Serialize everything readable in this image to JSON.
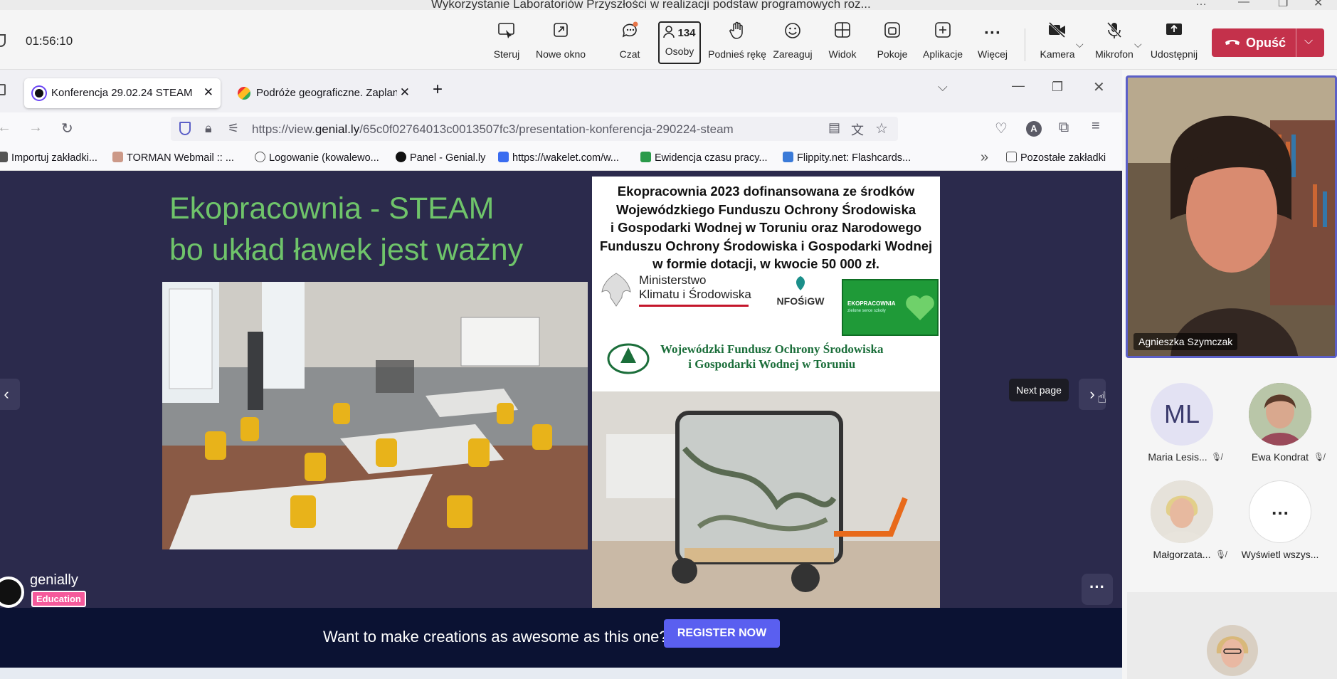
{
  "window": {
    "title": "Wykorzystanie Laboratoriów Przyszłości w realizacji podstaw programowych roz...",
    "controls": [
      "…",
      "—",
      "❐",
      "✕"
    ]
  },
  "meeting": {
    "timer": "01:56:10",
    "toolbar": [
      {
        "label": "Steruj",
        "icon": "control-icon"
      },
      {
        "label": "Nowe okno",
        "icon": "pop-out-icon"
      },
      {
        "label": "Czat",
        "icon": "chat-icon"
      },
      {
        "label": "Osoby",
        "icon": "people-icon",
        "count": "134"
      },
      {
        "label": "Podnieś rękę",
        "icon": "raise-hand-icon"
      },
      {
        "label": "Zareaguj",
        "icon": "react-icon"
      },
      {
        "label": "Widok",
        "icon": "view-icon"
      },
      {
        "label": "Pokoje",
        "icon": "rooms-icon"
      },
      {
        "label": "Aplikacje",
        "icon": "apps-icon"
      },
      {
        "label": "Więcej",
        "icon": "more-icon"
      },
      {
        "label": "Kamera",
        "icon": "camera-off-icon"
      },
      {
        "label": "Mikrofon",
        "icon": "mic-off-icon"
      },
      {
        "label": "Udostępnij",
        "icon": "share-icon"
      }
    ],
    "leave_label": "Opuść",
    "accent": "#5b5fc7",
    "leave_color": "#c4314b"
  },
  "browser": {
    "tabs": [
      {
        "title": "Konferencja 29.02.24 STEAM",
        "active": true
      },
      {
        "title": "Podróże geograficzne. Zaplanuj",
        "active": false
      }
    ],
    "new_tab": "+",
    "url_prefix": "https://view.",
    "url_domain": "genial.ly",
    "url_path": "/65c0f02764013c0013507fc3/presentation-konferencja-290224-steam",
    "bookmarks": [
      "Importuj zakładki...",
      "TORMAN Webmail :: ...",
      "Logowanie (kowalewo...",
      "Panel - Genial.ly",
      "https://wakelet.com/w...",
      "Ewidencja czasu pracy...",
      "Flippity.net: Flashcards...",
      "Pozostałe zakładki"
    ]
  },
  "slide": {
    "title_line1": "Ekopracownia - STEAM",
    "title_line2": "bo układ ławek jest ważny",
    "funding_text": [
      "Ekopracownia 2023 dofinansowana ze środków",
      "Wojewódzkiego Funduszu Ochrony Środowiska",
      "i Gospodarki Wodnej w Toruniu oraz Narodowego",
      "Funduszu Ochrony Środowiska i Gospodarki Wodnej",
      "w formie dotacji, w kwocie 50 000 zł."
    ],
    "logo_ministry": [
      "Ministerstwo",
      "Klimatu i Środowiska"
    ],
    "logo_nfosigw": "NFOŚiGW",
    "logo_ekopracownia": "EKOPRACOWNIA",
    "logo_ekopracownia_sub": "zielone serce szkoły",
    "logo_wfos": [
      "Wojewódzki Fundusz Ochrony Środowiska",
      "i Gospodarki Wodnej w Toruniu"
    ],
    "tooltip": "Next page",
    "brand": "genially",
    "brand_badge": "Education",
    "banner_text": "Want to make creations as awesome as this one?",
    "register_label": "REGISTER NOW",
    "title_color": "#6fc46a",
    "bg_color": "#2b2a4c"
  },
  "participants": {
    "speaker": "Agnieszka Szymczak",
    "list": [
      {
        "initials": "ML",
        "name": "Maria Lesis...",
        "muted": true
      },
      {
        "initials": "",
        "name": "Ewa Kondrat",
        "muted": true
      },
      {
        "initials": "",
        "name": "Małgorzata...",
        "muted": true
      },
      {
        "initials": "…",
        "name": "Wyświetl wszys...",
        "muted": false
      }
    ]
  }
}
